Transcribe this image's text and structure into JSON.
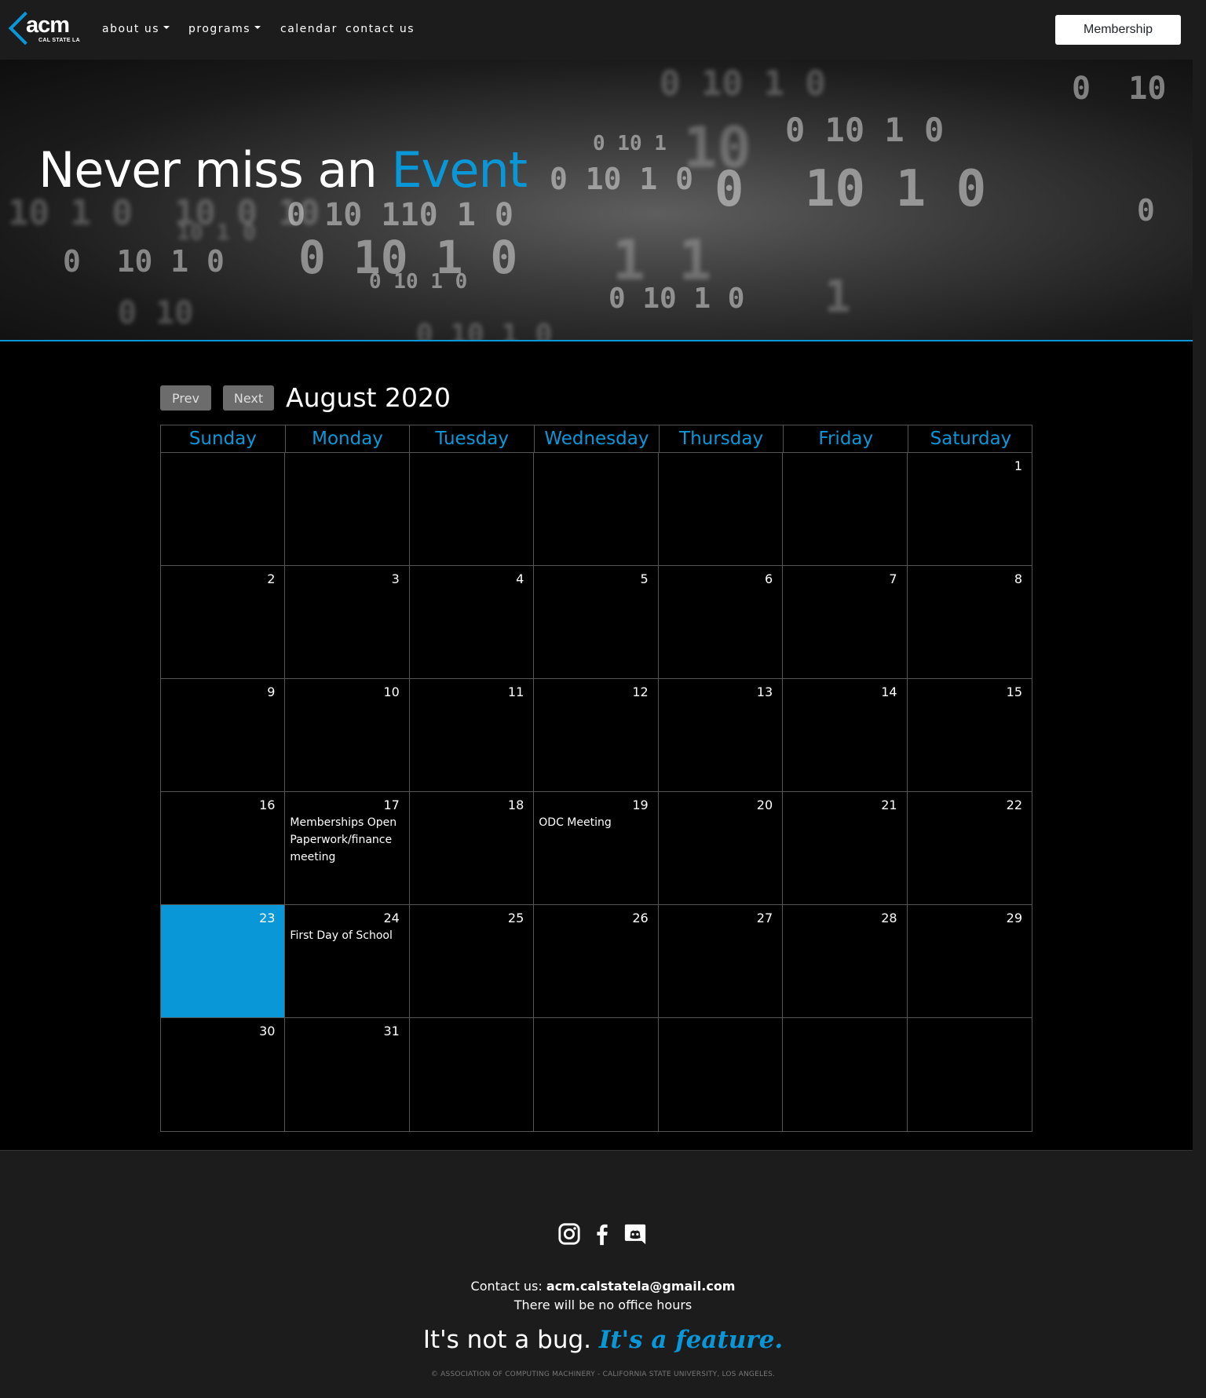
{
  "brand": {
    "logo_word": "acm",
    "logo_sub": "CAL STATE LA"
  },
  "nav": {
    "items": [
      {
        "label": "about us",
        "dropdown": true
      },
      {
        "label": "programs",
        "dropdown": true
      },
      {
        "label": "calendar",
        "dropdown": false
      },
      {
        "label": "contact us",
        "dropdown": false
      }
    ],
    "membership_label": "Membership"
  },
  "hero": {
    "title_plain": "Never miss an",
    "title_accent": "Event",
    "accent_color": "#0a97d8"
  },
  "calendar": {
    "prev_label": "Prev",
    "next_label": "Next",
    "month_title": "August 2020",
    "days_of_week": [
      "Sunday",
      "Monday",
      "Tuesday",
      "Wednesday",
      "Thursday",
      "Friday",
      "Saturday"
    ],
    "first_weekday": 6,
    "days_in_month": 31,
    "today": 23,
    "events": {
      "17": [
        "Memberships Open",
        "Paperwork/finance meeting"
      ],
      "19": [
        "ODC Meeting"
      ],
      "24": [
        "First Day of School"
      ]
    }
  },
  "footer": {
    "social_icons": [
      "instagram-icon",
      "facebook-icon",
      "discord-icon"
    ],
    "contact_prefix": "Contact us:",
    "contact_email": "acm.calstatela@gmail.com",
    "office_hours": "There will be no office hours",
    "tagline_plain": "It's not a bug.",
    "tagline_accent": "It's a feature.",
    "copyright": "© ASSOCIATION OF COMPUTING MACHINERY - CALIFORNIA STATE UNIVERSITY, LOS ANGELES."
  }
}
